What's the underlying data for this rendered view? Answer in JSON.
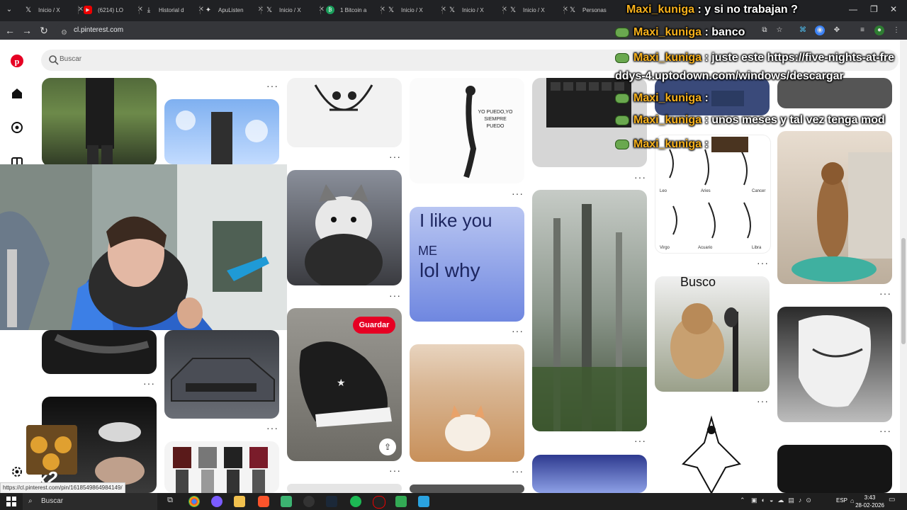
{
  "browser": {
    "tabs": [
      {
        "icon": "x-logo-icon",
        "label": "Inicio / X"
      },
      {
        "icon": "youtube-icon",
        "label": "(6214) LO"
      },
      {
        "icon": "download-icon",
        "label": "Historial d"
      },
      {
        "icon": "puzzle-icon",
        "label": "ApuListen"
      },
      {
        "icon": "x-logo-icon",
        "label": "Inicio / X"
      },
      {
        "icon": "bitcoin-icon",
        "label": "1 Bitcoin a"
      },
      {
        "icon": "x-logo-icon",
        "label": "Inicio / X"
      },
      {
        "icon": "x-logo-icon",
        "label": "Inicio / X"
      },
      {
        "icon": "x-logo-icon",
        "label": "Inicio / X"
      },
      {
        "icon": "x-logo-icon",
        "label": "Personas"
      }
    ],
    "url": "cl.pinterest.com"
  },
  "pinterest": {
    "search_placeholder": "Buscar",
    "save_label": "Guardar",
    "pin_texts": {
      "yo_puedo": "YO PUEDO,YO SIEMPRE PUEDO",
      "like_line1": "I like you",
      "like_line2": "ME",
      "like_line3": "lol why",
      "busco": "Busco",
      "zodiac": [
        "Leo",
        "Aries",
        "Cancer",
        "Virgo",
        "Acuario",
        "Libra"
      ]
    }
  },
  "chat": [
    {
      "user": "Maxi_kuniga",
      "message": "y si no trabajan ?"
    },
    {
      "user": "Maxi_kuniga",
      "message": "banco"
    },
    {
      "user": "Maxi_kuniga",
      "message": "juste este https://five-nights-at-freddys-4.uptodown.com/windows/descargar"
    },
    {
      "user": "Maxi_kuniga",
      "message": ""
    },
    {
      "user": "Maxi_kuniga",
      "message": "unos meses y tal vez tenga mod"
    },
    {
      "user": "Maxi_kuniga",
      "message": ""
    }
  ],
  "overlay": {
    "multiplier": "x2"
  },
  "statusbar": {
    "url": "https://cl.pinterest.com/pin/1618549864984149/"
  },
  "taskbar": {
    "search_label": "Buscar",
    "lang": "ESP",
    "time": "3:43",
    "date": "28-02-2026"
  },
  "colors": {
    "pinterest_red": "#e60023",
    "chat_user": "#f7b11c"
  }
}
